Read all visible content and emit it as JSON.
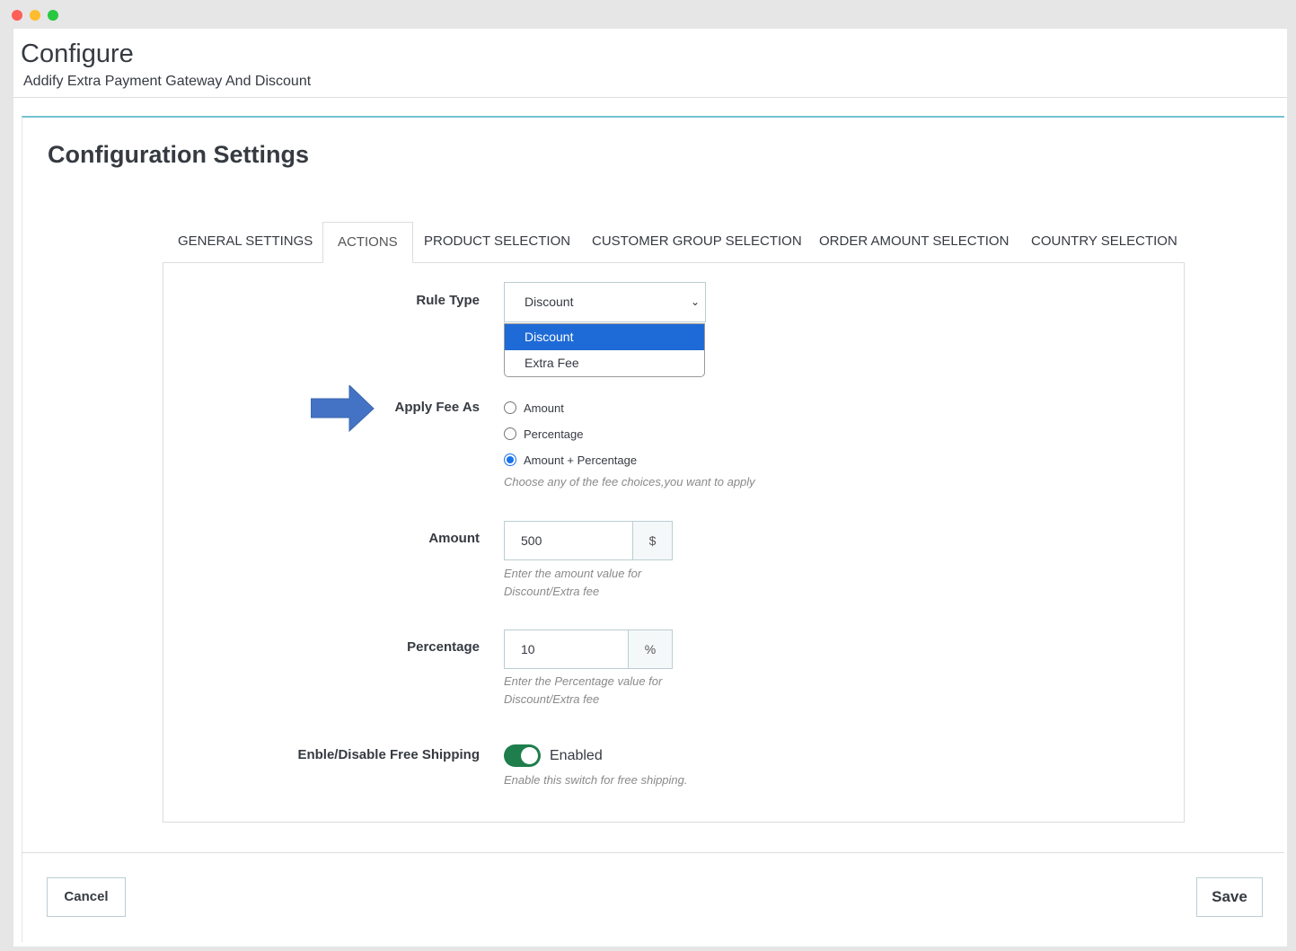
{
  "header": {
    "title": "Configure",
    "subtitle": "Addify Extra Payment Gateway And Discount"
  },
  "panel": {
    "title": "Configuration Settings"
  },
  "tabs": [
    {
      "label": "GENERAL SETTINGS"
    },
    {
      "label": "ACTIONS"
    },
    {
      "label": "PRODUCT SELECTION"
    },
    {
      "label": "CUSTOMER GROUP SELECTION"
    },
    {
      "label": "ORDER AMOUNT SELECTION"
    },
    {
      "label": "COUNTRY SELECTION"
    }
  ],
  "active_tab": "ACTIONS",
  "rule_type": {
    "label": "Rule Type",
    "selected": "Discount",
    "options": [
      "Discount",
      "Extra Fee"
    ]
  },
  "apply_fee": {
    "label": "Apply Fee As",
    "options": [
      "Amount",
      "Percentage",
      "Amount + Percentage"
    ],
    "checked": "Amount + Percentage",
    "help": "Choose any of the fee choices,you want to apply"
  },
  "amount": {
    "label": "Amount",
    "value": "500",
    "addon": "$",
    "help_line1": "Enter the amount value for",
    "help_line2": "Discount/Extra fee"
  },
  "percentage": {
    "label": "Percentage",
    "value": "10",
    "addon": "%",
    "help_line1": "Enter the Percentage value for",
    "help_line2": "Discount/Extra fee"
  },
  "free_shipping": {
    "label": "Enble/Disable Free Shipping",
    "state": "Enabled",
    "help": "Enable this switch for free shipping."
  },
  "footer": {
    "cancel_label": "Cancel",
    "save_label": "Save"
  },
  "colors": {
    "accent": "#74c3d1",
    "toggle_on": "#1e7e4c",
    "dropdown_highlight": "#1e6ad6",
    "arrow": "#4472c4"
  }
}
